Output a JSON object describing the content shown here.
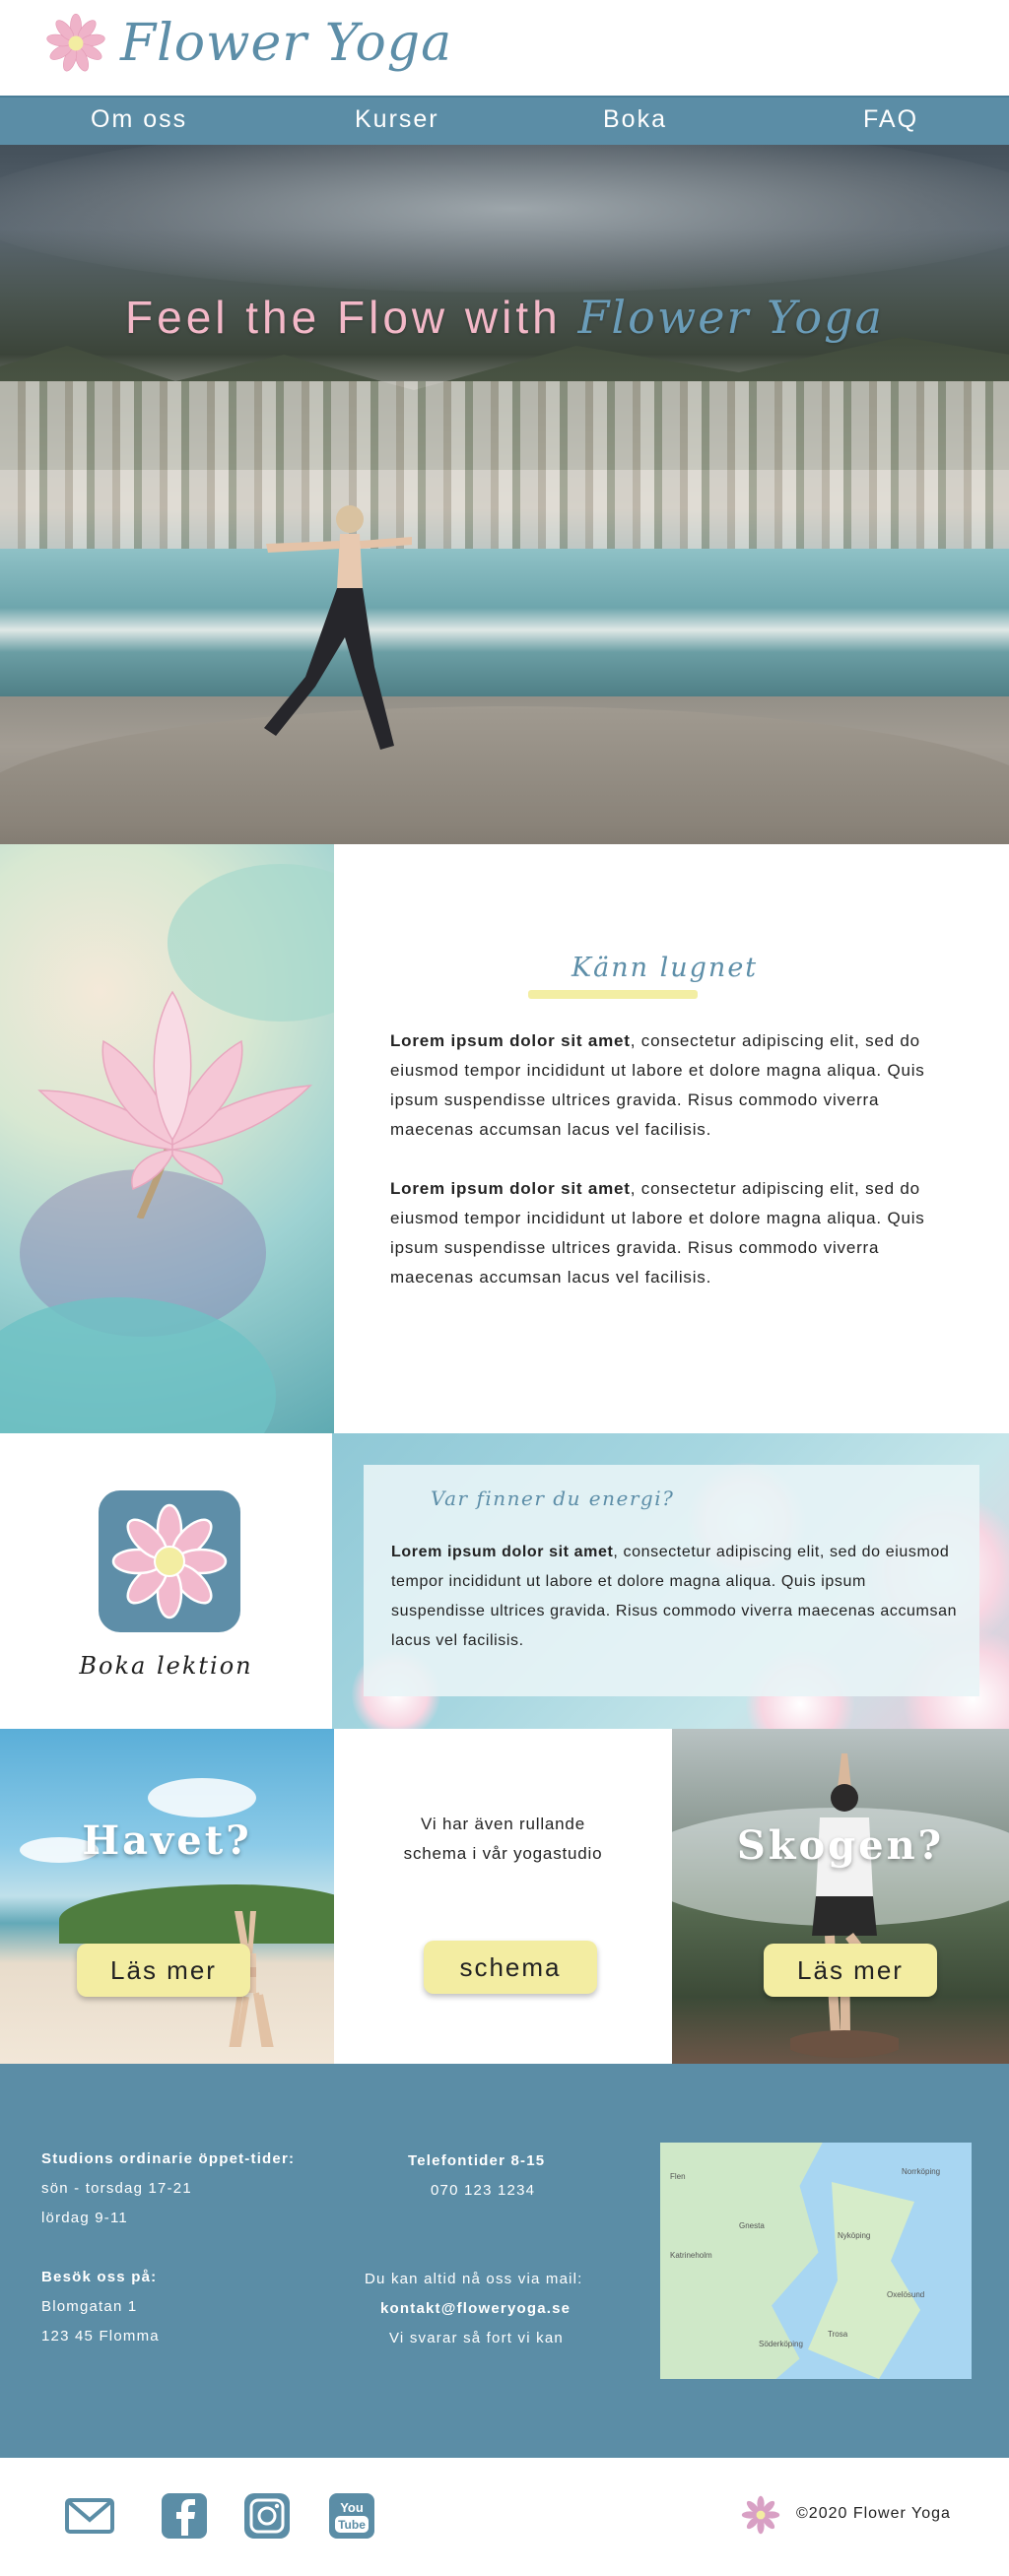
{
  "brand": {
    "name": "Flower Yoga"
  },
  "nav": [
    {
      "label": "Om oss"
    },
    {
      "label": "Kurser"
    },
    {
      "label": "Boka"
    },
    {
      "label": "FAQ"
    }
  ],
  "hero": {
    "title_prefix": "Feel the Flow with ",
    "title_accent": "Flower Yoga"
  },
  "feel": {
    "heading": "Känn lugnet",
    "paragraphs": [
      {
        "bold": "Lorem ipsum dolor sit amet",
        "text": ", consectetur adipiscing elit, sed do eiusmod tempor incididunt ut labore et dolore magna aliqua. Quis ipsum suspendisse ultrices gravida. Risus commodo viverra maecenas accumsan lacus vel facilisis."
      },
      {
        "bold": "Lorem ipsum dolor sit amet",
        "text": ", consectetur adipiscing elit, sed do eiusmod tempor incididunt ut labore et dolore magna aliqua. Quis ipsum suspendisse ultrices gravida. Risus commodo viverra maecenas accumsan lacus vel facilisis."
      }
    ]
  },
  "book": {
    "label": "Boka lektion"
  },
  "energy": {
    "heading": "Var finner du energi?",
    "bold": "Lorem ipsum dolor sit amet",
    "text": ", consectetur adipiscing elit, sed do eiusmod tempor incididunt ut labore et dolore magna aliqua. Quis ipsum suspendisse ultrices gravida. Risus commodo viverra maecenas accumsan lacus vel facilisis."
  },
  "panels": {
    "sea": {
      "title": "Havet?",
      "button": "Läs mer"
    },
    "middle": {
      "line1": "Vi har även rullande",
      "line2": "schema i vår yogastudio",
      "button": "schema"
    },
    "forest": {
      "title": "Skogen?",
      "button": "Läs mer"
    }
  },
  "contact": {
    "hours_heading": "Studions ordinarie öppet-tider:",
    "hours_1": "sön - torsdag 17-21",
    "hours_2": "lördag 9-11",
    "visit_heading": "Besök oss på:",
    "street": "Blomgatan 1",
    "city": "123 45 Flomma",
    "phone_heading": "Telefontider 8-15",
    "phone": "070 123 1234",
    "mail_intro": "Du kan altid nå oss via mail:",
    "email": "kontakt@floweryoga.se",
    "reply": "Vi svarar så fort vi kan"
  },
  "map": {
    "labels": [
      "Flen",
      "Gnesta",
      "Nyköping",
      "Oxelösund",
      "Katrineholm",
      "Trosa",
      "Söderköping",
      "Norrköping"
    ]
  },
  "footer": {
    "copyright": "©2020 Flower Yoga"
  },
  "colors": {
    "primary": "#5b8da6",
    "accent_yellow": "#f3eda2",
    "pink": "#f3b8c8"
  },
  "icons": [
    "lotus-logo-icon",
    "mail-icon",
    "facebook-icon",
    "instagram-icon",
    "youtube-icon"
  ]
}
